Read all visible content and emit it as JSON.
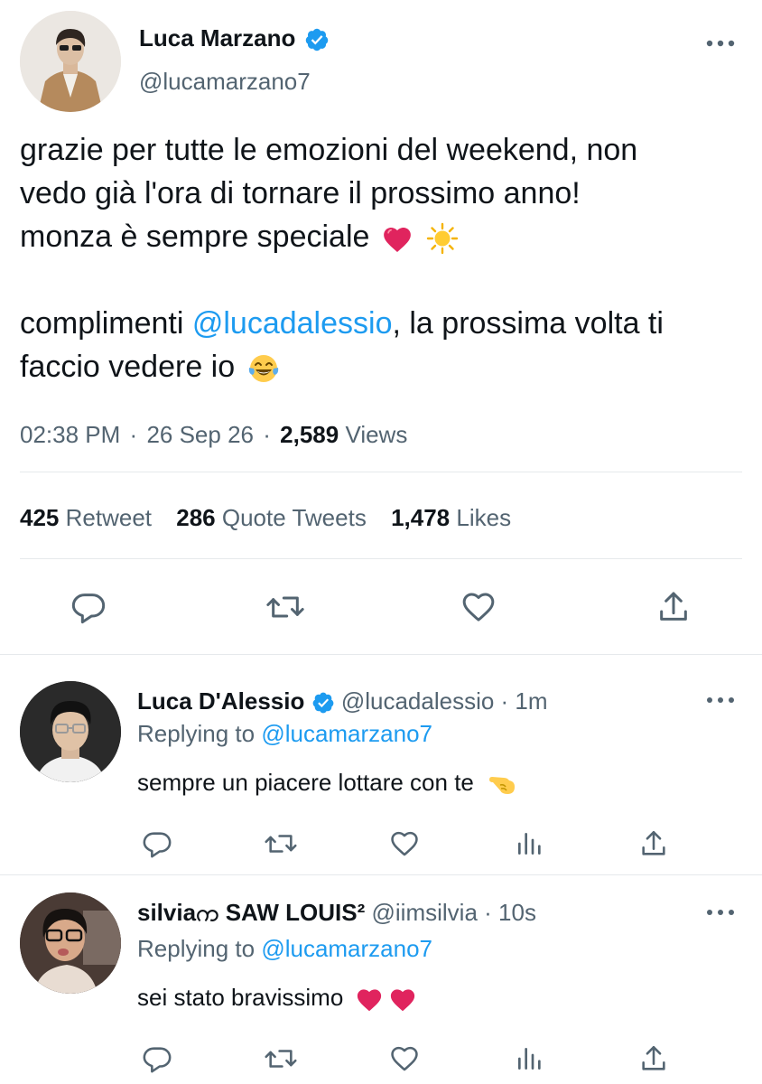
{
  "main_tweet": {
    "author_name": "Luca Marzano",
    "author_handle": "@lucamarzano7",
    "line1": "grazie per tutte le emozioni del weekend, non",
    "line2": "vedo già l'ora di tornare il prossimo anno!",
    "line3": "monza è sempre speciale",
    "line4_pre": "complimenti ",
    "line4_mention": "@lucadalessio",
    "line4_post": ", la prossima volta ti",
    "line5": "faccio vedere io",
    "time": "02:38 PM",
    "dot": "·",
    "date": "26 Sep 26",
    "views_count": "2,589",
    "views_label": "Views",
    "retweets_count": "425",
    "retweets_label": "Retweet",
    "quotes_count": "286",
    "quotes_label": "Quote Tweets",
    "likes_count": "1,478",
    "likes_label": "Likes"
  },
  "replies": [
    {
      "author_name": "Luca D'Alessio",
      "author_handle": "@lucadalessio",
      "time": "· 1m",
      "replying_prefix": "Replying to",
      "replying_to": "@lucamarzano7",
      "text": "sempre un piacere lottare con te"
    },
    {
      "author_name": "silviaက SAW LOUIS²",
      "author_handle": "@iimsilvia",
      "time": "· 10s",
      "replying_prefix": "Replying to",
      "replying_to": "@lucamarzano7",
      "text": "sei stato bravissimo"
    }
  ],
  "colors": {
    "accent": "#1d9bf0",
    "text": "#0f1419",
    "secondary": "#536471",
    "heart": "#e0245e"
  }
}
